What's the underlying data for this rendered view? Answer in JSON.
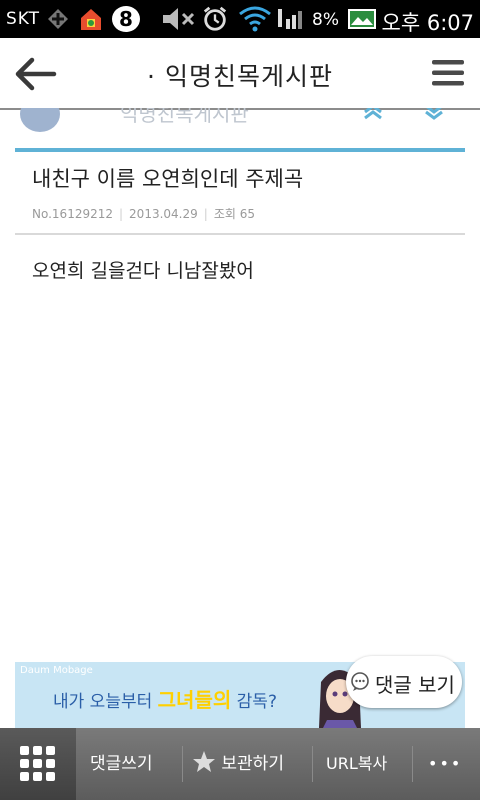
{
  "status_bar": {
    "carrier": "SKT",
    "icons": [
      "add-notification-icon",
      "home-app-icon",
      "badge-8-icon",
      "mute-icon",
      "alarm-icon",
      "wifi-icon",
      "signal-icon",
      "gallery-icon"
    ],
    "badge": "8",
    "battery": "8%",
    "time": "오후 6:07"
  },
  "header": {
    "title": "· 익명친목게시판"
  },
  "board_strip": {
    "name": "익명친목게시판"
  },
  "post": {
    "title": "내친구 이름 오연희인데 주제곡",
    "number": "No.16129212",
    "date": "2013.04.29",
    "views": "조회 65",
    "body": "오연희 길을걷다 니남잘봤어"
  },
  "ad": {
    "brand": "Daum Mobage",
    "text_before": "내가 오늘부터",
    "text_highlight": "그녀들의",
    "text_after": "감독?"
  },
  "comment_view_button": "댓글 보기",
  "toolbar": {
    "write_comment": "댓글쓰기",
    "bookmark": "보관하기",
    "copy_url": "URL복사",
    "more": "•••"
  },
  "colors": {
    "accent": "#5fb2d6",
    "ad_highlight": "#ffd000",
    "toolbar": "#6a6a6a"
  }
}
